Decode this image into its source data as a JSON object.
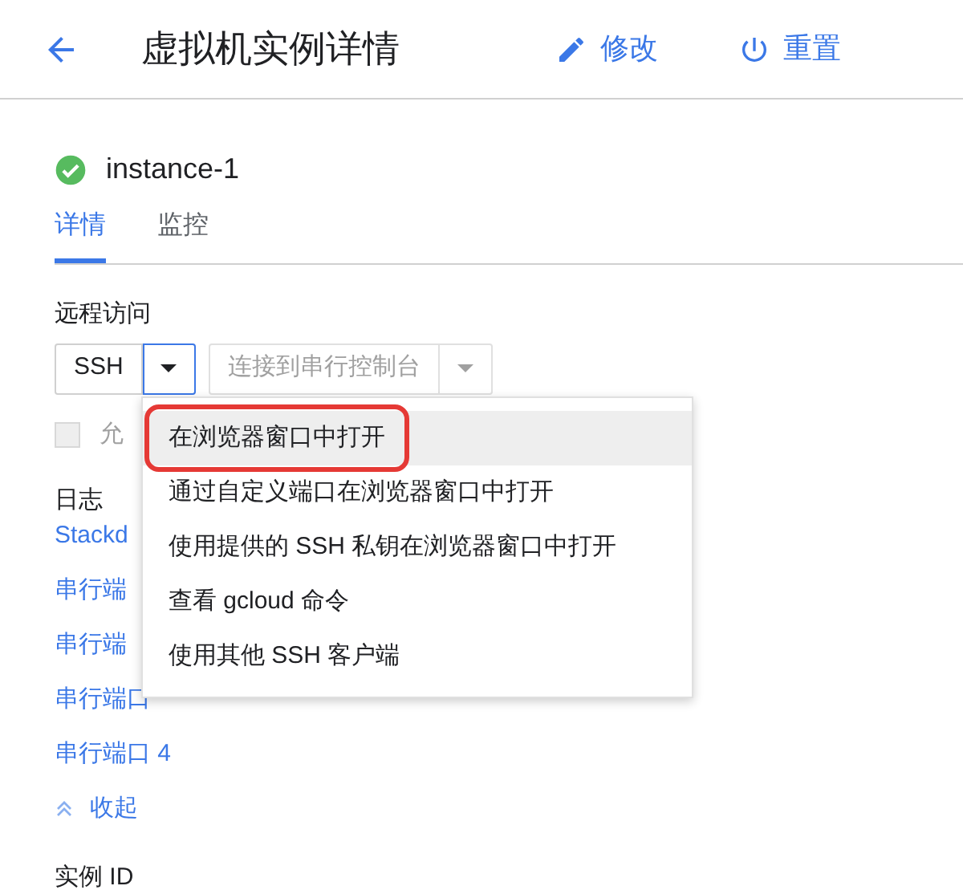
{
  "header": {
    "title": "虚拟机实例详情",
    "actions": [
      {
        "kind": "edit",
        "label": "修改"
      },
      {
        "kind": "reset",
        "label": "重置"
      }
    ]
  },
  "instance": {
    "name": "instance-1",
    "running": true
  },
  "tabs": [
    {
      "label": "详情",
      "selected": true
    },
    {
      "label": "监控",
      "selected": false
    }
  ],
  "remote_access": {
    "label": "远程访问",
    "ssh_button": "SSH",
    "serial_button": "连接到串行控制台",
    "serial_disabled": true,
    "checkbox_label": "允",
    "checkbox_checked": false,
    "checkbox_disabled": true
  },
  "logs": {
    "label": "日志",
    "links": [
      "Stackd",
      "串行端",
      "串行端",
      "串行端口",
      "串行端口 4"
    ],
    "collapse": "收起"
  },
  "instance_id_label": "实例 ID",
  "menu": {
    "items": [
      {
        "label": "在浏览器窗口中打开",
        "selected": true
      },
      {
        "label": "通过自定义端口在浏览器窗口中打开",
        "selected": false
      },
      {
        "label": "使用提供的 SSH 私钥在浏览器窗口中打开",
        "selected": false
      },
      {
        "label": "查看 gcloud 命令",
        "selected": false
      },
      {
        "label": "使用其他 SSH 客户端",
        "selected": false
      }
    ]
  }
}
